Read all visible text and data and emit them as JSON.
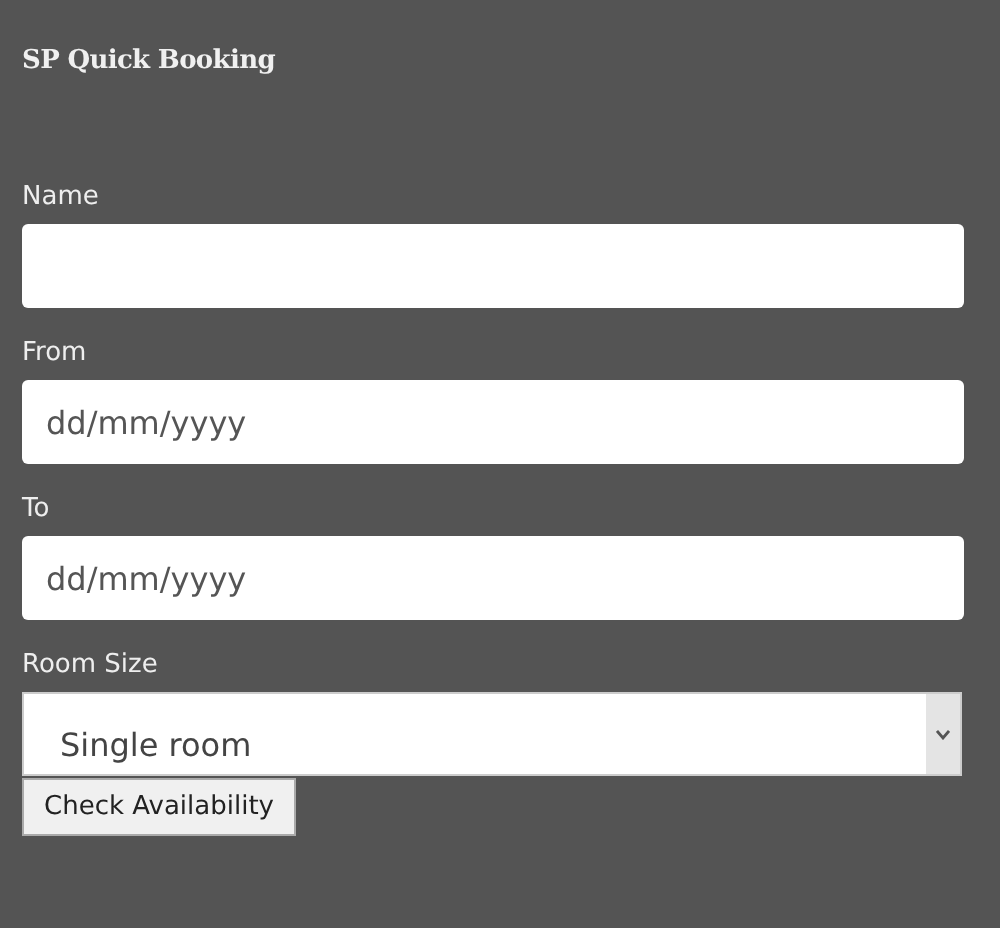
{
  "title": "SP Quick Booking",
  "fields": [
    {
      "kind": "text",
      "label": "Name"
    },
    {
      "kind": "text",
      "label": "From",
      "placeholder": "dd/mm/yyyy"
    },
    {
      "kind": "text",
      "label": "To",
      "placeholder": "dd/mm/yyyy"
    },
    {
      "kind": "select",
      "label": "Room Size",
      "value": "Single room"
    }
  ],
  "button": "Check Availability"
}
